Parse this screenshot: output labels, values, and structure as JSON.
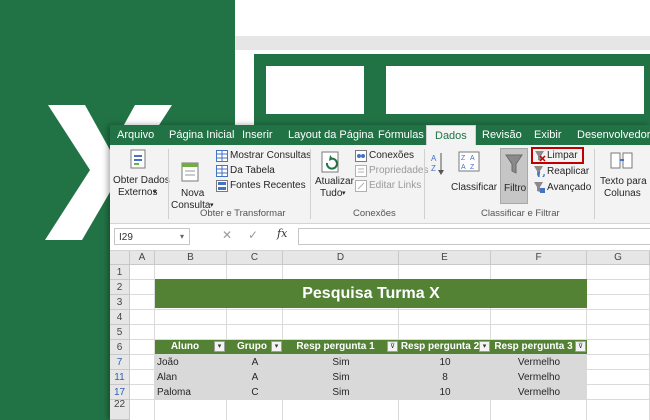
{
  "ribbon_tabs": [
    "Arquivo",
    "Página Inicial",
    "Inserir",
    "Layout da Página",
    "Fórmulas",
    "Dados",
    "Revisão",
    "Exibir",
    "Desenvolvedor"
  ],
  "ribbon": {
    "obter_dados": "Obter Dados",
    "externos": "Externos",
    "nova": "Nova",
    "consulta": "Consulta",
    "mostrar_consultas": "Mostrar Consultas",
    "da_tabela": "Da Tabela",
    "fontes_recentes": "Fontes Recentes",
    "group_obter": "Obter e Transformar",
    "atualizar": "Atualizar",
    "tudo": "Tudo",
    "conexoes_btn": "Conexões",
    "propriedades": "Propriedades",
    "editar_links": "Editar Links",
    "group_conexoes": "Conexões",
    "classificar": "Classificar",
    "filtro": "Filtro",
    "limpar": "Limpar",
    "reaplicar": "Reaplicar",
    "avancado": "Avançado",
    "group_classificar": "Classificar e Filtrar",
    "texto_para": "Texto para",
    "colunas": "Colunas"
  },
  "formula_bar": {
    "name_box": "I29",
    "fx": "fx",
    "cancel": "✕",
    "enter": "✓"
  },
  "columns": [
    "A",
    "B",
    "C",
    "D",
    "E",
    "F",
    "G"
  ],
  "rows": [
    "1",
    "2",
    "3",
    "4",
    "5",
    "6",
    "7",
    "11",
    "17",
    "22"
  ],
  "sheet": {
    "title": "Pesquisa Turma X",
    "headers": [
      "Aluno",
      "Grupo",
      "Resp pergunta 1",
      "Resp pergunta 2",
      "Resp pergunta 3"
    ],
    "data": [
      [
        "João",
        "A",
        "Sim",
        "10",
        "Vermelho"
      ],
      [
        "Alan",
        "A",
        "Sim",
        "8",
        "Vermelho"
      ],
      [
        "Paloma",
        "C",
        "Sim",
        "10",
        "Vermelho"
      ]
    ]
  },
  "colors": {
    "excel_green": "#217346",
    "table_green": "#548235",
    "highlight_border": "#c00000"
  }
}
